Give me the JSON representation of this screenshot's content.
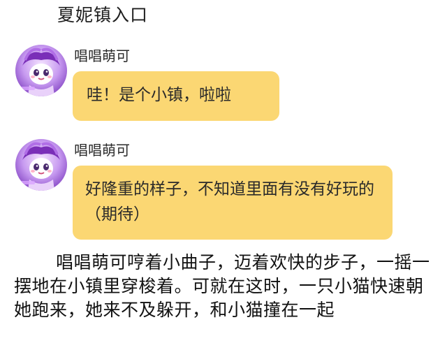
{
  "header": {
    "title": "夏妮镇入口"
  },
  "messages": [
    {
      "sender": "唱唱萌可",
      "text": "哇！是个小镇，啦啦",
      "avatar_icon": "cartoon-character-avatar"
    },
    {
      "sender": "唱唱萌可",
      "text": "好隆重的样子，不知道里面有没有好玩的（期待）",
      "avatar_icon": "cartoon-character-avatar"
    }
  ],
  "narration": "唱唱萌可哼着小曲子，迈着欢快的步子，一摇一摆地在小镇里穿梭着。可就在这时，一只小猫快速朝她跑来，她来不及躲开，和小猫撞在一起",
  "colors": {
    "bubble": "#fbd773",
    "avatar_purple": "#9b5fd0",
    "text": "#1e1e1e"
  }
}
